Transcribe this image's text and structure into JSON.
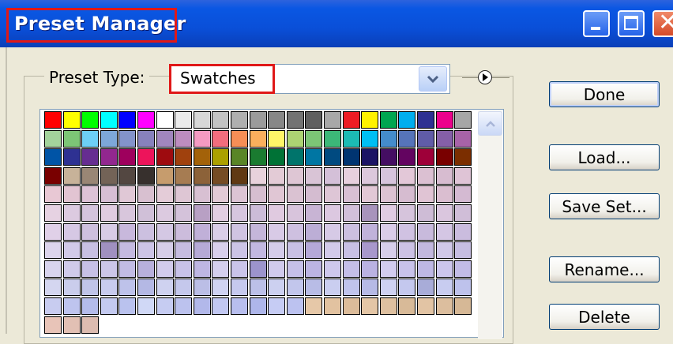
{
  "window": {
    "title": "Preset Manager",
    "controls": [
      "minimize-icon",
      "maximize-icon",
      "close-icon"
    ],
    "accent_color": "#0a4fd8",
    "highlight_color": "#e01818"
  },
  "preset_type": {
    "label": "Preset Type:",
    "value": "Swatches"
  },
  "buttons": {
    "done": "Done",
    "load": "Load...",
    "save_set": "Save Set...",
    "rename": "Rename...",
    "delete": "Delete"
  },
  "swatch_rows": [
    [
      "#ff0000",
      "#ffff00",
      "#00ff00",
      "#00ffff",
      "#0000ff",
      "#ff00ff",
      "#ffffff",
      "#ebebeb",
      "#d7d7d7",
      "#c3c3c3",
      "#afafaf",
      "#9b9b9b",
      "#878787",
      "#737373",
      "#5f5f5f",
      "#a8a8a8",
      "#ed1c24",
      "#fff200",
      "#00a651",
      "#00aeef",
      "#2e3192",
      "#ec008c",
      "#a6a6a6"
    ],
    [
      "#a3d39c",
      "#7cc576",
      "#6dcff6",
      "#7da7d9",
      "#8393ca",
      "#8781bd",
      "#a186be",
      "#bd8cbf",
      "#f49ac2",
      "#f26d7d",
      "#f68e56",
      "#fbaf5d",
      "#fff568",
      "#acd373",
      "#7cc576",
      "#3cb878",
      "#1cbbb4",
      "#00bff3",
      "#448ccb",
      "#5674b9",
      "#605ca8",
      "#855fa8",
      "#a763a8"
    ],
    [
      "#0054a6",
      "#2e3192",
      "#662d91",
      "#92278f",
      "#9e005d",
      "#ed145b",
      "#9e0b0f",
      "#a0410d",
      "#a36209",
      "#aba000",
      "#598527",
      "#1a7b30",
      "#007236",
      "#00746b",
      "#0076a3",
      "#004a80",
      "#003471",
      "#1b1464",
      "#440e62",
      "#630460",
      "#9e0039",
      "#790000",
      "#7b2e00"
    ],
    [
      "#790000",
      "#c7b299",
      "#998675",
      "#736357",
      "#534741",
      "#37302d",
      "#c69c6d",
      "#a67c52",
      "#8c6239",
      "#754c24",
      "#603913",
      "#e8d2dc",
      "#e3cbd6",
      "#dec6d4",
      "#d9c4d6",
      "#d4c0d8",
      "#e7d0de",
      "#dcc8dc",
      "#d6c4dc",
      "#e3c8d8",
      "#dbc0d2",
      "#d7bcd0",
      "#dfc4d6"
    ],
    [
      "#e8c8d4",
      "#e2c4d2",
      "#dcc2d6",
      "#d6bed4",
      "#e0c8d6",
      "#d8c0d0",
      "#e4ccd8",
      "#dec6d4",
      "#d8c0d2",
      "#e2cad6",
      "#dcc4d4",
      "#d6bed0",
      "#e0c6d4",
      "#dac2d2",
      "#d4bcd0",
      "#dec6d6",
      "#d8c0d4",
      "#e2c8d6",
      "#dcc2d2",
      "#d6bcd0",
      "#e0c4d4",
      "#dabed0",
      "#d4bad2"
    ],
    [
      "#e6d2e2",
      "#dccae0",
      "#d4c4dc",
      "#e0cce0",
      "#d8c6dc",
      "#d0c0d8",
      "#dccae0",
      "#d4c2da",
      "#b8a0c4",
      "#e2cee2",
      "#d6c6de",
      "#ccbcd8",
      "#e0cae0",
      "#d8c4dc",
      "#c8b4d4",
      "#dcc8e0",
      "#d2c0da",
      "#a894bc",
      "#e0cce2",
      "#d6c4dc",
      "#cebcd6",
      "#dac6de",
      "#d0bed8"
    ],
    [
      "#e0d0e8",
      "#d6c8e4",
      "#cec0de",
      "#d8cce6",
      "#c8b8dc",
      "#ccc0e0",
      "#d4c8e4",
      "#ccbcdc",
      "#c0b0d8",
      "#dacee8",
      "#d0c4e2",
      "#c4b6da",
      "#d8cae6",
      "#cec0e0",
      "#bcaed6",
      "#d6cae6",
      "#ccc0e0",
      "#c0b2da",
      "#dacce8",
      "#d0c2e2",
      "#c8badc",
      "#d4c6e4",
      "#cabcde"
    ],
    [
      "#dcd4ec",
      "#d2cae8",
      "#c8c0e2",
      "#a090c0",
      "#c4bae0",
      "#ccc4e6",
      "#d6cee8",
      "#c6bce0",
      "#b6aad6",
      "#d8d0ec",
      "#ccc4e6",
      "#c2b8e0",
      "#d4ccea",
      "#c8c0e4",
      "#b4a8d8",
      "#d2caea",
      "#c8c0e4",
      "#a898cc",
      "#d6ceea",
      "#ccc2e4",
      "#c2b8de",
      "#d0c8e8",
      "#c6bee2"
    ],
    [
      "#d8d4ee",
      "#d0caea",
      "#c6c0e6",
      "#ccc6e8",
      "#c2bce4",
      "#b8b0dc",
      "#d2ccec",
      "#c8c2e8",
      "#beb6e2",
      "#d4cfee",
      "#cac4ea",
      "#9c94cc",
      "#d0caec",
      "#c6c0e8",
      "#bcb4e2",
      "#cec8ec",
      "#c4bee8",
      "#bab2e2",
      "#d2ccee",
      "#c8c2ea",
      "#beb8e4",
      "#ccc6ec",
      "#c2bce6"
    ],
    [
      "#d4d6f0",
      "#cacdec",
      "#c0c4e8",
      "#c8cbee",
      "#bec2ea",
      "#b4b8e4",
      "#cfd2f0",
      "#c5c8ec",
      "#bbbee6",
      "#d0d3f2",
      "#c6c9ee",
      "#bcc0e8",
      "#ccd0f0",
      "#c2c6ec",
      "#b8bce6",
      "#cacef0",
      "#c0c4ec",
      "#b6bae6",
      "#ced1f2",
      "#c4c8ee",
      "#a8acd8",
      "#c8ccf0",
      "#bec2ec"
    ],
    [
      "#c8ccf0",
      "#bec4ee",
      "#b4bcea",
      "#c4caf0",
      "#bac2ee",
      "#d0d8f6",
      "#c6ccf2",
      "#bcc2ee",
      "#b2b8ea",
      "#c2c8f2",
      "#b8beee",
      "#aeb6ea",
      "#c6ccf4",
      "#bcc2f0",
      "#e6c8a8",
      "#e2c2a0",
      "#dcbc9a",
      "#e4c6a6",
      "#dec0a0",
      "#d8ba98",
      "#e2c4a4",
      "#dcbe9e",
      "#d6b896"
    ],
    [
      "#e8c4b8",
      "#e2c0b4",
      "#dcbcb0"
    ]
  ]
}
